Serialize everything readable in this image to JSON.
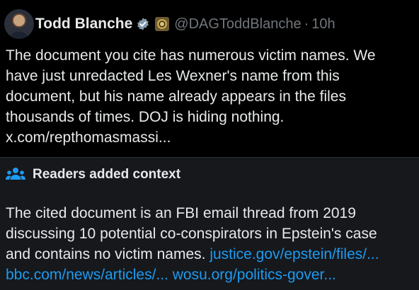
{
  "post": {
    "author_name": "Todd Blanche",
    "handle": "@DAGToddBlanche",
    "separator": "·",
    "time": "10h",
    "lines": [
      "The document you cite has numerous victim names.  We",
      "have just unredacted Les Wexner's name from this",
      "document, but his name already appears in the files",
      "thousands of times.  DOJ is hiding nothing."
    ],
    "link": "x.com/repthomasmassi..."
  },
  "community_notes": {
    "title": "Readers added context",
    "lines": [
      "The cited document is an FBI email thread from 2019",
      "discussing 10 potential co-conspirators in Epstein's case"
    ],
    "line3_text": "and contains no victim names. ",
    "links": [
      "justice.gov/epstein/files/...",
      "bbc.com/news/articles/...",
      "wosu.org/politics-gover..."
    ]
  },
  "colors": {
    "background": "#000000",
    "notes_background": "#16181c",
    "text": "#e7e9ea",
    "secondary_text": "#71767b",
    "link": "#1d9bf0",
    "verified_badge": "#829aab"
  },
  "icons": {
    "verified": "verified-badge-icon",
    "affiliate": "doj-seal-icon",
    "notes": "people-icon"
  }
}
